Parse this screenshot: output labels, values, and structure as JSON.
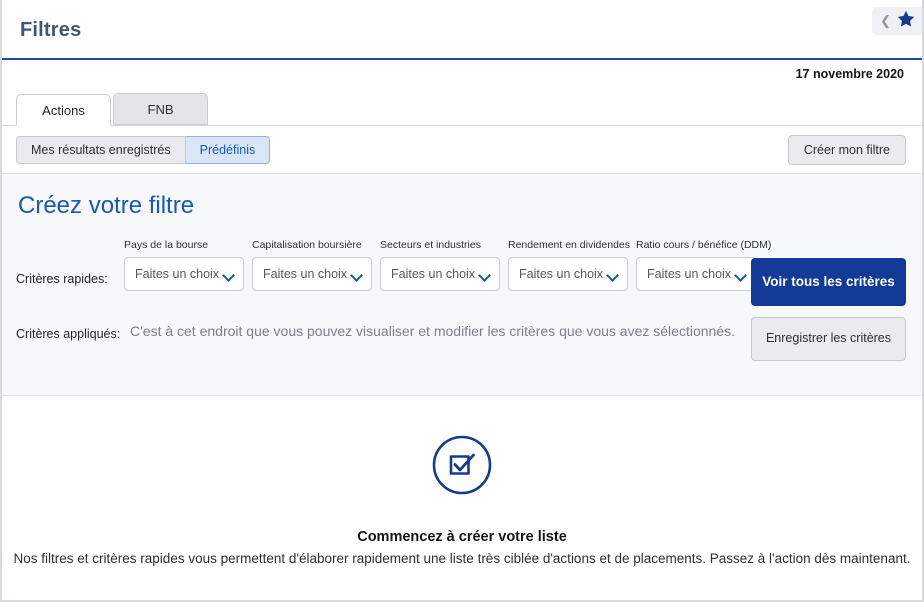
{
  "header": {
    "title": "Filtres",
    "back_icon": "chevron-left-icon",
    "favorite_icon": "star-icon"
  },
  "date": "17 novembre 2020",
  "tabs": [
    {
      "label": "Actions",
      "active": true
    },
    {
      "label": "FNB",
      "active": false
    }
  ],
  "toolbar": {
    "segments": [
      {
        "label": "Mes résultats enregistrés",
        "active": false
      },
      {
        "label": "Prédéfinis",
        "active": true
      }
    ],
    "create_filter_label": "Créer mon filtre"
  },
  "page_heading": "Créez votre filtre",
  "filter_panel": {
    "quick_criteria_label": "Critères rapides:",
    "applied_criteria_label": "Critères appliqués:",
    "applied_criteria_text": "C'est à cet endroit que vous pouvez visualiser et modifier les critères que vous avez sélectionnés.",
    "dropdowns": [
      {
        "label": "Pays de la bourse",
        "value": "Faites un choix"
      },
      {
        "label": "Capitalisation boursière",
        "value": "Faites un choix"
      },
      {
        "label": "Secteurs et industries",
        "value": "Faites un choix"
      },
      {
        "label": "Rendement en dividendes",
        "value": "Faites un choix"
      },
      {
        "label": "Ratio cours / bénéfice (DDM)",
        "value": "Faites un choix"
      }
    ],
    "see_all_label": "Voir tous les critères",
    "save_criteria_label": "Enregistrer les critères"
  },
  "empty_state": {
    "icon": "checkbox-circle-icon",
    "title": "Commencez à créer votre liste",
    "subtitle": "Nos filtres et critères rapides vous permettent d'élaborer rapidement une liste très ciblée d'actions et de placements. Passez à l'action dès maintenant."
  },
  "colors": {
    "brand_blue": "#123a96",
    "link_blue": "#1b58b5",
    "header_rule": "#1f47a3",
    "panel_bg": "#f7f8fa"
  }
}
